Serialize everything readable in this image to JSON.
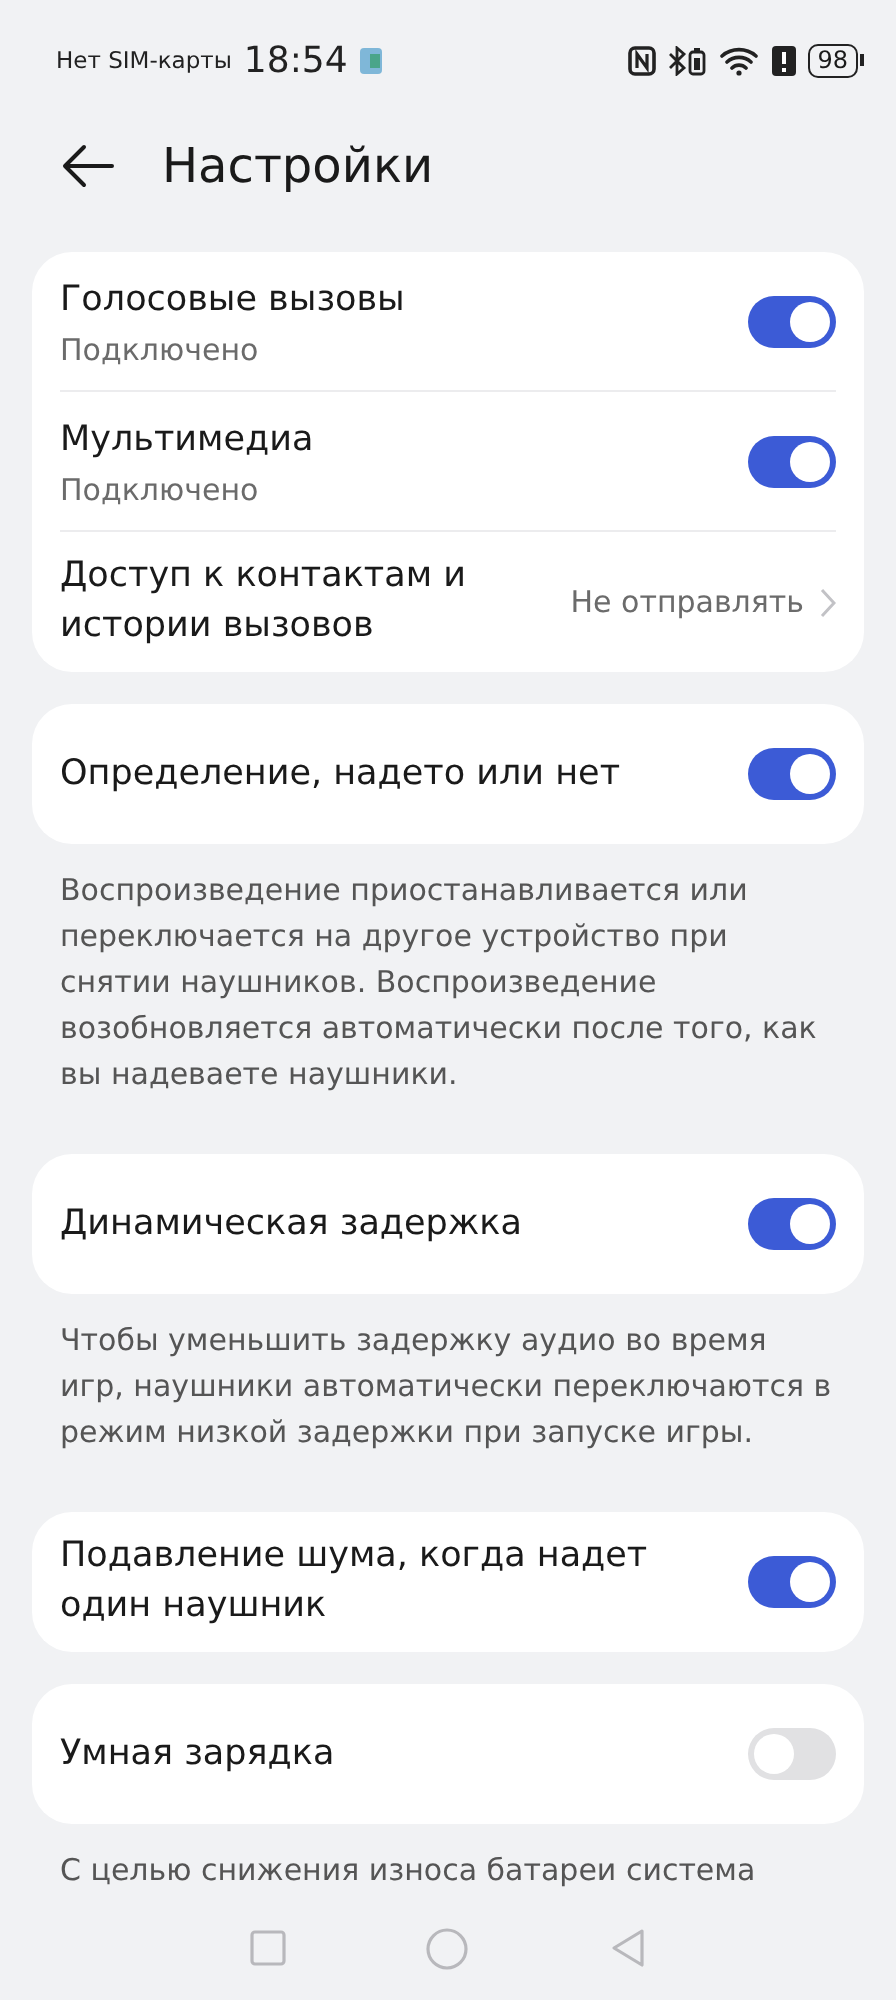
{
  "status_bar": {
    "carrier": "Нет SIM-карты",
    "time": "18:54",
    "battery": "98"
  },
  "header": {
    "title": "Настройки"
  },
  "sections": [
    {
      "rows": [
        {
          "kind": "toggle",
          "title": "Голосовые вызовы",
          "subtitle": "Подключено",
          "on": true
        },
        {
          "kind": "toggle",
          "title": "Мультимедиа",
          "subtitle": "Подключено",
          "on": true
        },
        {
          "kind": "link",
          "title": "Доступ к контактам и истории вызовов",
          "value": "Не отправлять"
        }
      ]
    },
    {
      "rows": [
        {
          "kind": "toggle",
          "title": "Определение, надето или нет",
          "on": true
        }
      ],
      "note": "Воспроизведение приостанавливается или переключается на другое устройство при снятии наушников. Воспроизведение возобновляется автоматически после того, как вы надеваете наушники."
    },
    {
      "rows": [
        {
          "kind": "toggle",
          "title": "Динамическая задержка",
          "on": true
        }
      ],
      "note": "Чтобы уменьшить задержку аудио во время игр, наушники автоматически переключаются в режим низкой задержки при запуске игры."
    },
    {
      "rows": [
        {
          "kind": "toggle",
          "title": "Подавление шума, когда надет один наушник",
          "on": true
        }
      ]
    },
    {
      "rows": [
        {
          "kind": "toggle",
          "title": "Умная зарядка",
          "on": false
        }
      ],
      "note": "С целью снижения износа батареи система"
    }
  ]
}
